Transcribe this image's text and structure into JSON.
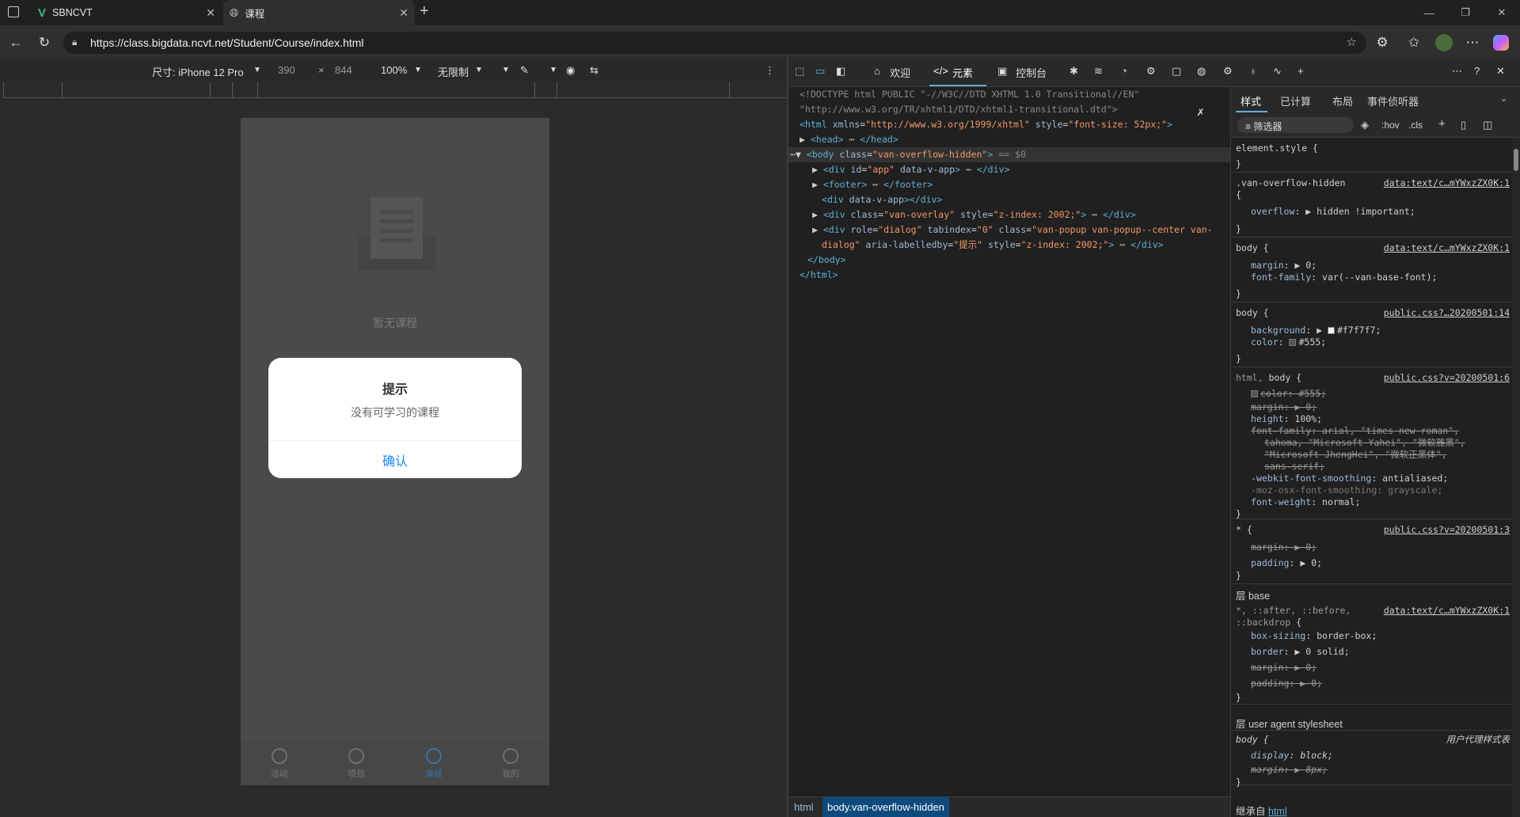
{
  "browser": {
    "tabs": [
      {
        "title": "SBNCVT"
      },
      {
        "title": "课程"
      }
    ],
    "url": "https://class.bigdata.ncvt.net/Student/Course/index.html"
  },
  "device_toolbar": {
    "device": "尺寸: iPhone 12 Pro",
    "width": "390",
    "x": "×",
    "height": "844",
    "zoom": "100%",
    "throttle": "无限制"
  },
  "page": {
    "empty_text": "暂无课程",
    "tabbar": [
      {
        "label": "活动"
      },
      {
        "label": "项目"
      },
      {
        "label": "课程"
      },
      {
        "label": "我的"
      }
    ],
    "dialog": {
      "title": "提示",
      "message": "没有可学习的课程",
      "confirm": "确认"
    }
  },
  "devtools": {
    "tools": {
      "welcome": "欢迎",
      "elements": "元素",
      "console": "控制台"
    },
    "style_tabs": [
      "样式",
      "已计算",
      "布局",
      "事件侦听器"
    ],
    "filter_placeholder": "筛选器",
    "hov": ":hov",
    "cls": ".cls",
    "breadcrumb": [
      "html",
      "body.van-overflow-hidden"
    ],
    "dom": {
      "doctype1": "<!DOCTYPE html PUBLIC \"-//W3C//DTD XHTML 1.0 Transitional//EN\"",
      "doctype2": "\"http://www.w3.org/TR/xhtml1/DTD/xhtml1-transitional.dtd\">"
    },
    "styles": {
      "element_style": "element.style {",
      "layer_base": "层 base",
      "layer_ua": "层 user agent stylesheet",
      "ua_label": "用户代理样式表",
      "inherited": "继承自"
    }
  },
  "colors": {
    "accent": "#1989fa",
    "link_blue": "#5db0d7"
  }
}
